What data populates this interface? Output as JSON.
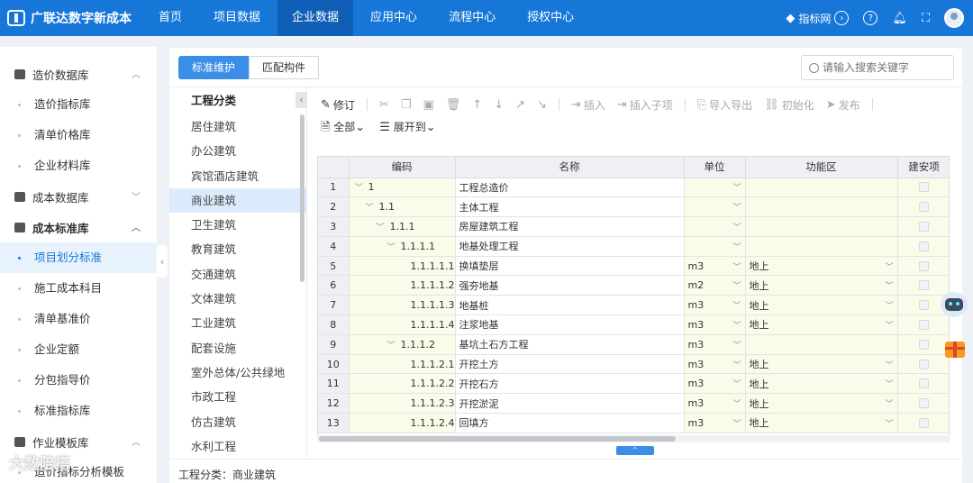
{
  "app": {
    "title": "广联达数字新成本"
  },
  "nav": [
    {
      "label": "首页",
      "active": false
    },
    {
      "label": "项目数据",
      "active": false
    },
    {
      "label": "企业数据",
      "active": true
    },
    {
      "label": "应用中心",
      "active": false
    },
    {
      "label": "流程中心",
      "active": false
    },
    {
      "label": "授权中心",
      "active": false
    }
  ],
  "topright": {
    "index_label": "指标网"
  },
  "sidebar": {
    "groups": [
      {
        "label": "造价数据库",
        "expanded": true,
        "items": [
          "造价指标库",
          "清单价格库",
          "企业材料库"
        ]
      },
      {
        "label": "成本数据库",
        "expanded": false,
        "items": []
      },
      {
        "label": "成本标准库",
        "expanded": true,
        "items": [
          "项目划分标准",
          "施工成本科目",
          "清单基准价",
          "企业定额",
          "分包指导价",
          "标准指标库"
        ]
      },
      {
        "label": "作业模板库",
        "expanded": true,
        "items": [
          "造价指标分析模板"
        ]
      }
    ],
    "active_item": "项目划分标准"
  },
  "watermark": "大数陪搭",
  "tabs": [
    {
      "label": "标准维护",
      "active": true
    },
    {
      "label": "匹配构件",
      "active": false
    }
  ],
  "search": {
    "placeholder": "请输入搜索关键字",
    "value": ""
  },
  "category": {
    "title": "工程分类",
    "items": [
      "居住建筑",
      "办公建筑",
      "宾馆酒店建筑",
      "商业建筑",
      "卫生建筑",
      "教育建筑",
      "交通建筑",
      "文体建筑",
      "工业建筑",
      "配套设施",
      "室外总体/公共绿地",
      "市政工程",
      "仿古建筑",
      "水利工程"
    ],
    "active": "商业建筑"
  },
  "toolbar": {
    "revise": "修订",
    "insert": "插入",
    "insert_child": "插入子项",
    "import_export": "导入导出",
    "initialize": "初始化",
    "publish": "发布",
    "all": "全部",
    "expand_to": "展开到"
  },
  "grid": {
    "columns": [
      "编码",
      "名称",
      "单位",
      "功能区",
      "建安项"
    ],
    "rows": [
      {
        "n": "1",
        "indent": 0,
        "arrow": true,
        "code": "1",
        "name": "工程总造价",
        "unit": "",
        "zone": ""
      },
      {
        "n": "2",
        "indent": 1,
        "arrow": true,
        "code": "1.1",
        "name": "主体工程",
        "unit": "",
        "zone": ""
      },
      {
        "n": "3",
        "indent": 2,
        "arrow": true,
        "code": "1.1.1",
        "name": "房屋建筑工程",
        "unit": "",
        "zone": ""
      },
      {
        "n": "4",
        "indent": 3,
        "arrow": true,
        "code": "1.1.1.1",
        "name": "地基处理工程",
        "unit": "",
        "zone": ""
      },
      {
        "n": "5",
        "indent": 4,
        "arrow": false,
        "code": "1.1.1.1.1",
        "name": "换填垫层",
        "unit": "m3",
        "zone": "地上"
      },
      {
        "n": "6",
        "indent": 4,
        "arrow": false,
        "code": "1.1.1.1.2",
        "name": "强夯地基",
        "unit": "m2",
        "zone": "地上"
      },
      {
        "n": "7",
        "indent": 4,
        "arrow": false,
        "code": "1.1.1.1.3",
        "name": "地基桩",
        "unit": "m3",
        "zone": "地上"
      },
      {
        "n": "8",
        "indent": 4,
        "arrow": false,
        "code": "1.1.1.1.4",
        "name": "注浆地基",
        "unit": "m3",
        "zone": "地上"
      },
      {
        "n": "9",
        "indent": 3,
        "arrow": true,
        "code": "1.1.1.2",
        "name": "基坑土石方工程",
        "unit": "m3",
        "zone": ""
      },
      {
        "n": "10",
        "indent": 4,
        "arrow": false,
        "code": "1.1.1.2.1",
        "name": "开挖土方",
        "unit": "m3",
        "zone": "地上"
      },
      {
        "n": "11",
        "indent": 4,
        "arrow": false,
        "code": "1.1.1.2.2",
        "name": "开挖石方",
        "unit": "m3",
        "zone": "地上"
      },
      {
        "n": "12",
        "indent": 4,
        "arrow": false,
        "code": "1.1.1.2.3",
        "name": "开挖淤泥",
        "unit": "m3",
        "zone": "地上"
      },
      {
        "n": "13",
        "indent": 4,
        "arrow": false,
        "code": "1.1.1.2.4",
        "name": "回填方",
        "unit": "m3",
        "zone": "地上"
      }
    ]
  },
  "footer": {
    "label": "工程分类：",
    "value": "商业建筑"
  }
}
